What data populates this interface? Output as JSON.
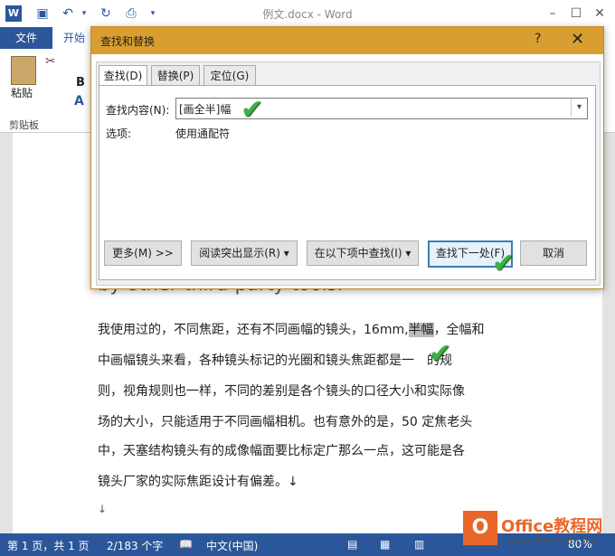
{
  "window": {
    "title": "例文.docx - Word",
    "app_icon": "W",
    "help": "?"
  },
  "ribbon": {
    "tabs": [
      "文件",
      "开始"
    ],
    "paste_label": "粘贴",
    "bold_label": "B",
    "clipboard_group": "剪贴板"
  },
  "document": {
    "ghost_line": "by other third-party tools.↵",
    "lines": [
      [
        "我使用过的，不同焦距，还有不同画幅的镜头，16mm,",
        "半幅",
        "，全幅和"
      ],
      [
        "中画幅镜头来看，各种镜头标记的光圈和镜头焦距都是一",
        "",
        "的规"
      ],
      [
        "则，视角规则也一样，不同的差别是各个镜头的口径大小和实际像",
        "",
        ""
      ],
      [
        "场的大小，只能适用于不同画幅相机。也有意外的是，50 定焦老头",
        "",
        ""
      ],
      [
        "中，天塞结构镜头有的成像幅面要比标定广那么一点，这可能是各",
        "",
        ""
      ],
      [
        "镜头厂家的实际焦距设计有偏差。↓",
        "",
        ""
      ]
    ],
    "return_mark": "↓"
  },
  "dialog": {
    "title": "查找和替换",
    "tabs": [
      "查找(D)",
      "替换(P)",
      "定位(G)"
    ],
    "find_label": "查找内容(N):",
    "find_value": "[画全半]幅",
    "options_label": "选项:",
    "options_value": "使用通配符",
    "buttons": {
      "more": "更多(M) >>",
      "reading_highlight": "阅读突出显示(R) ▾",
      "find_in": "在以下项中查找(I) ▾",
      "find_next": "查找下一处(F)",
      "cancel": "取消"
    }
  },
  "statusbar": {
    "page": "第 1 页，共 1 页",
    "words": "2/183 个字",
    "language": "中文(中国)",
    "zoom": "80%"
  },
  "watermark": {
    "name": "Office教程网",
    "url": "www.office26.com"
  },
  "colors": {
    "accent": "#2b579a",
    "dialog_header": "#d89e32",
    "check": "#3cb043",
    "logo": "#e9672a"
  }
}
